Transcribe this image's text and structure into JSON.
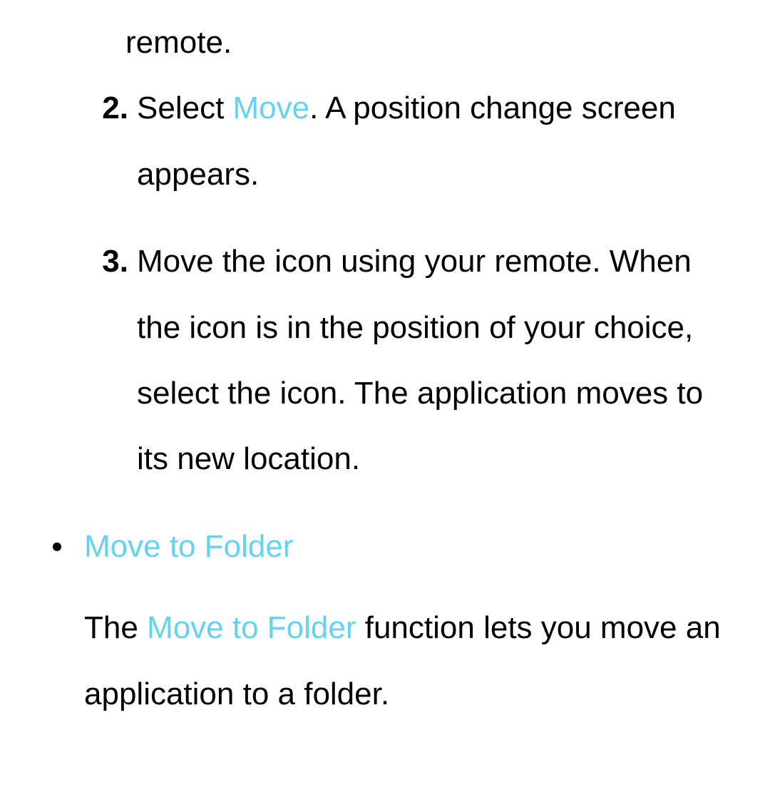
{
  "fragment": {
    "text": "remote."
  },
  "step2": {
    "marker": "2.",
    "pre": "Select ",
    "hl": "Move",
    "post": ". A position change screen appears."
  },
  "step3": {
    "marker": "3.",
    "text": "Move the icon using your remote. When the icon is in the position of your choice, select the icon. The application moves to its new location."
  },
  "section": {
    "title": "Move to Folder",
    "desc_pre": "The ",
    "desc_hl": "Move to Folder",
    "desc_post": " function lets you move an application to a folder."
  }
}
